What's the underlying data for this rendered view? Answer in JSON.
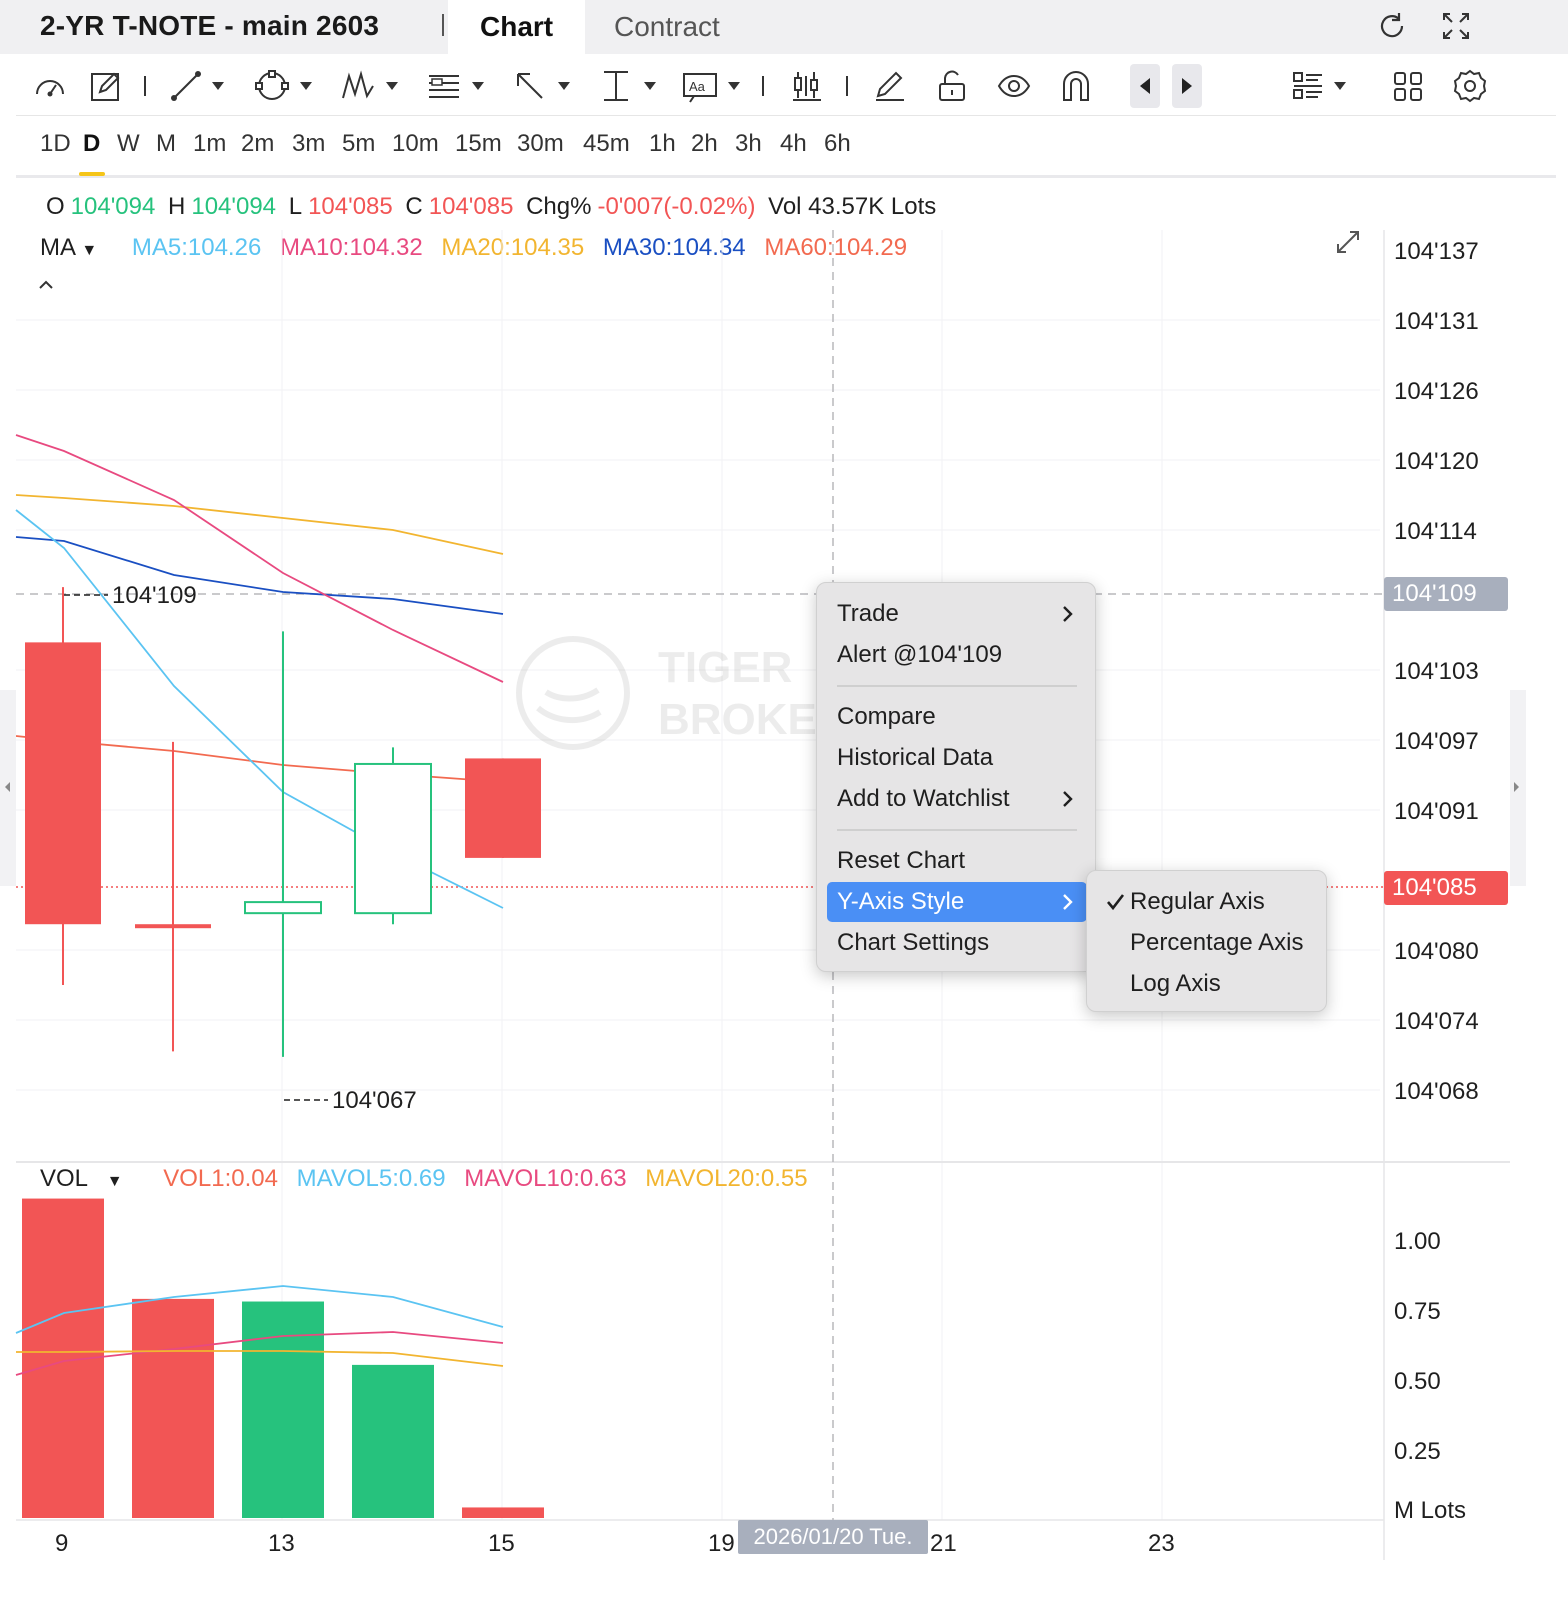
{
  "header": {
    "symbol_title": "2-YR T-NOTE - main 2603",
    "tabs": [
      {
        "label": "Chart",
        "active": true
      },
      {
        "label": "Contract",
        "active": false
      }
    ],
    "icons": [
      "refresh-icon",
      "fullscreen-icon"
    ]
  },
  "toolbar": {
    "tools": [
      "indicator-gauge-icon",
      "edit-icon",
      "line-tool-icon",
      "shape-tool-icon",
      "pattern-tool-icon",
      "fibonacci-tool-icon",
      "arrow-tool-icon",
      "measure-tool-icon",
      "text-tool-icon",
      "candlestick-icon",
      "pencil-icon",
      "unlock-icon",
      "eye-icon",
      "magnet-icon",
      "prev-icon",
      "next-icon",
      "layout-list-icon",
      "grid-icon",
      "gear-icon"
    ]
  },
  "periods": {
    "items": [
      "1D",
      "D",
      "W",
      "M",
      "1m",
      "2m",
      "3m",
      "5m",
      "10m",
      "15m",
      "30m",
      "45m",
      "1h",
      "2h",
      "3h",
      "4h",
      "6h"
    ],
    "active": "D"
  },
  "ohlc": {
    "o_label": "O",
    "o_value": "104'094",
    "h_label": "H",
    "h_value": "104'094",
    "l_label": "L",
    "l_value": "104'085",
    "c_label": "C",
    "c_value": "104'085",
    "chg_label": "Chg%",
    "chg_value": "-0'007(-0.02%)",
    "vol_text": "Vol 43.57K Lots"
  },
  "ma_legend": {
    "label": "MA",
    "items": [
      {
        "text": "MA5:104.26",
        "color": "#5bc4f2"
      },
      {
        "text": "MA10:104.32",
        "color": "#e84a80"
      },
      {
        "text": "MA20:104.35",
        "color": "#f2b530"
      },
      {
        "text": "MA30:104.34",
        "color": "#1a4fc2"
      },
      {
        "text": "MA60:104.29",
        "color": "#f26a50"
      }
    ]
  },
  "price_axis": {
    "labels": [
      "104'137",
      "104'131",
      "104'126",
      "104'120",
      "104'114",
      "104'103",
      "104'097",
      "104'091",
      "104'080",
      "104'074",
      "104'068"
    ],
    "crosshair_tag": "104'109",
    "last_price_tag": "104'085",
    "high_marker": "104'109",
    "low_marker": "104'067"
  },
  "volume": {
    "label": "VOL",
    "items": [
      {
        "text": "VOL1:0.04",
        "color": "#f26a50"
      },
      {
        "text": "MAVOL5:0.69",
        "color": "#5bc4f2"
      },
      {
        "text": "MAVOL10:0.63",
        "color": "#e84a80"
      },
      {
        "text": "MAVOL20:0.55",
        "color": "#f2b530"
      }
    ],
    "axis_labels": [
      "1.00",
      "0.75",
      "0.50",
      "0.25",
      "M Lots"
    ]
  },
  "time_axis": {
    "labels": [
      "9",
      "13",
      "15",
      "19",
      "21",
      "23"
    ],
    "crosshair_date": "2026/01/20 Tue."
  },
  "context_menu": {
    "items": [
      {
        "label": "Trade",
        "submenu": true
      },
      {
        "label": "Alert @104'109",
        "submenu": false
      },
      {
        "label": "Compare",
        "submenu": false
      },
      {
        "label": "Historical Data",
        "submenu": false
      },
      {
        "label": "Add to Watchlist",
        "submenu": true
      },
      {
        "label": "Reset Chart",
        "submenu": false
      },
      {
        "label": "Y-Axis Style",
        "submenu": true,
        "highlighted": true
      },
      {
        "label": "Chart Settings",
        "submenu": false
      }
    ],
    "y_axis_submenu": [
      {
        "label": "Regular Axis",
        "checked": true
      },
      {
        "label": "Percentage Axis",
        "checked": false
      },
      {
        "label": "Log Axis",
        "checked": false
      }
    ]
  },
  "chart_data": {
    "type": "candlestick",
    "candles": [
      {
        "x": "9",
        "open": 104.1045,
        "high": 104.1095,
        "low": 104.0735,
        "close": 104.079,
        "direction": "down"
      },
      {
        "x": "12",
        "open": 104.079,
        "high": 104.0955,
        "low": 104.0675,
        "close": 104.079,
        "direction": "down"
      },
      {
        "x": "13",
        "open": 104.08,
        "high": 104.1055,
        "low": 104.067,
        "close": 104.081,
        "direction": "up"
      },
      {
        "x": "14",
        "open": 104.08,
        "high": 104.095,
        "low": 104.079,
        "close": 104.0935,
        "direction": "up"
      },
      {
        "x": "15",
        "open": 104.094,
        "high": 104.094,
        "low": 104.085,
        "close": 104.085,
        "direction": "down"
      }
    ],
    "volume": [
      {
        "x": "9",
        "value": 1.21,
        "direction": "down"
      },
      {
        "x": "12",
        "value": 0.83,
        "direction": "down"
      },
      {
        "x": "13",
        "value": 0.82,
        "direction": "up"
      },
      {
        "x": "14",
        "value": 0.58,
        "direction": "up"
      },
      {
        "x": "15",
        "value": 0.04,
        "direction": "down"
      }
    ],
    "ylim": [
      104.064,
      104.14
    ],
    "vol_ylim": [
      0,
      1.25
    ]
  }
}
